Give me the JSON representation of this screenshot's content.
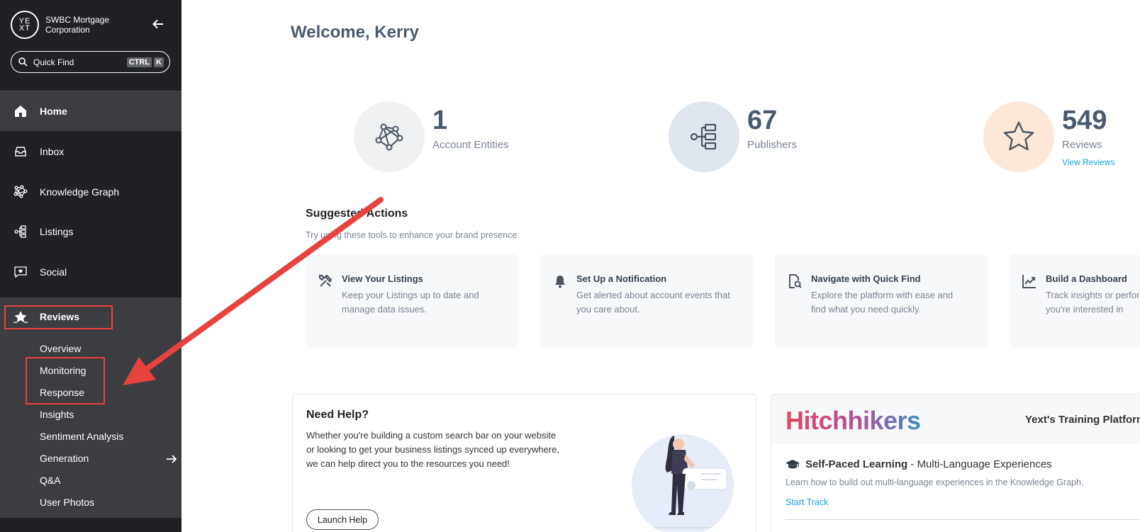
{
  "sidebar": {
    "logo_text": "YEXT",
    "org_name": "SWBC Mortgage Corporation",
    "back_icon": "arrow-left-icon",
    "quick_find": {
      "label": "Quick Find",
      "shortcut_keys": [
        "CTRL",
        "K"
      ]
    },
    "nav": [
      {
        "label": "Home",
        "icon": "home-icon",
        "active": true
      },
      {
        "label": "Inbox",
        "icon": "inbox-icon"
      },
      {
        "label": "Knowledge Graph",
        "icon": "knowledge-graph-icon"
      },
      {
        "label": "Listings",
        "icon": "listings-icon"
      },
      {
        "label": "Social",
        "icon": "social-icon"
      },
      {
        "label": "Reviews",
        "icon": "reviews-icon",
        "expanded": true
      }
    ],
    "review_subitems": [
      "Overview",
      "Monitoring",
      "Response",
      "Insights",
      "Sentiment Analysis",
      "Generation",
      "Q&A",
      "User Photos"
    ]
  },
  "main": {
    "welcome": "Welcome, Kerry",
    "stats": [
      {
        "value": "1",
        "label": "Account Entities",
        "icon": "network-icon",
        "color": "#f0f1f3"
      },
      {
        "value": "67",
        "label": "Publishers",
        "icon": "listings-tree-icon",
        "color": "#dfe6ee"
      },
      {
        "value": "549",
        "label": "Reviews",
        "icon": "star-icon",
        "color": "#fce8d9",
        "link": "View Reviews"
      }
    ],
    "suggested": {
      "title": "Suggested Actions",
      "subtitle": "Try using these tools to enhance your brand presence.",
      "cards": [
        {
          "title": "View Your Listings",
          "desc": "Keep your Listings up to date and manage data issues.",
          "icon": "tools-icon"
        },
        {
          "title": "Set Up a Notification",
          "desc": "Get alerted about account events that you care about.",
          "icon": "bell-icon"
        },
        {
          "title": "Navigate with Quick Find",
          "desc": "Explore the platform with ease and find what you need quickly.",
          "icon": "search-document-icon"
        },
        {
          "title": "Build a Dashboard",
          "desc": "Track insights or performance that you're interested in",
          "icon": "chart-line-icon"
        }
      ]
    },
    "help": {
      "title": "Need Help?",
      "text": "Whether you're building a custom search bar on your website or looking to get your business listings synced up everywhere, we can help direct you to the resources you need!",
      "button": "Launch Help"
    },
    "hitchhikers": {
      "logo": "Hitchhikers",
      "tagline": "Yext's Training Platform",
      "course_title": "Self-Paced Learning",
      "course_sep": " - ",
      "course_subtitle": "Multi-Language Experiences",
      "course_desc": "Learn how to build out multi-language experiences in the Knowledge Graph.",
      "link": "Start Track"
    }
  },
  "colors": {
    "sidebar_bg": "#202124",
    "sidebar_active": "#3c3d40",
    "accent_link": "#1aa0d8",
    "highlight_red": "#e8423f",
    "heading": "#4b5b6e"
  }
}
